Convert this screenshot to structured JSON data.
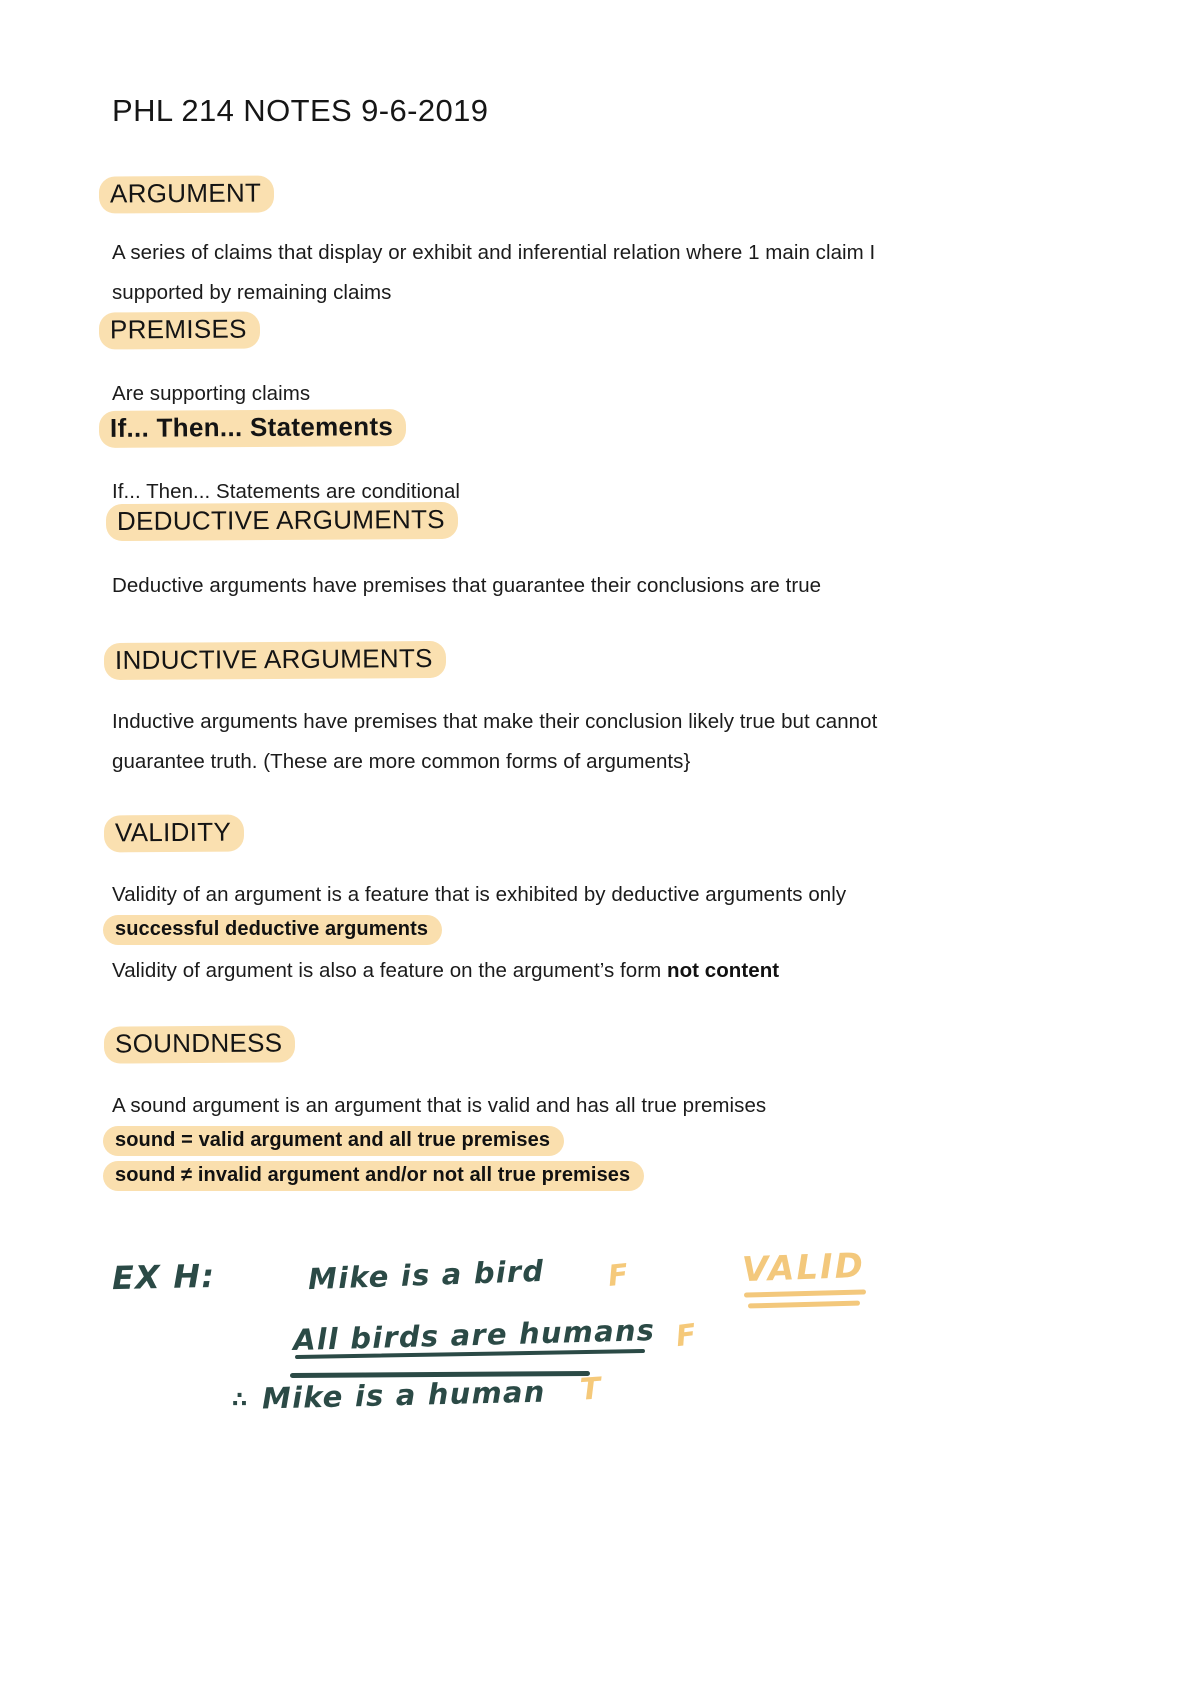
{
  "document": {
    "title": "PHL 214 NOTES 9-6-2019",
    "accent_highlight": "#fae0b0",
    "ink_color": "#2b4a46",
    "marker_color": "#f3c87c"
  },
  "sections": [
    {
      "heading": "ARGUMENT",
      "body": "A series of claims that display or exhibit and inferential relation where 1 main claim I\nsupported by remaining claims"
    },
    {
      "heading": "PREMISES",
      "body": "Are supporting claims"
    },
    {
      "heading": "If... Then... Statements",
      "body": "If... Then... Statements are conditional"
    },
    {
      "heading": "DEDUCTIVE ARGUMENTS",
      "body": "Deductive arguments have premises that guarantee their conclusions are true"
    },
    {
      "heading": "INDUCTIVE ARGUMENTS",
      "body": "Inductive arguments have premises that make their conclusion likely true but cannot\nguarantee truth. (These are more common forms of arguments}"
    },
    {
      "heading": "VALIDITY",
      "body": "Validity of an argument is a feature that is exhibited by deductive arguments only",
      "definition_strip": "successful deductive arguments",
      "body2_prefix": "Validity of argument is also a feature on the argument’s form ",
      "body2_bold": "not content"
    },
    {
      "heading": "SOUNDNESS",
      "body": "A sound argument is an argument that is valid and has all true premises",
      "definition_strips": [
        "sound = valid argument and all true premises",
        "sound ≠ invalid argument and/or not all true premises"
      ]
    }
  ],
  "handwritten_example": {
    "label": "EX H:",
    "premise_1": "Mike is a bird",
    "premise_1_value": "F",
    "premise_2": "All birds are humans",
    "premise_2_value": "F",
    "conclusion_symbol": "∴",
    "conclusion": "Mike is a human",
    "conclusion_value": "T",
    "verdict": "VALID"
  }
}
